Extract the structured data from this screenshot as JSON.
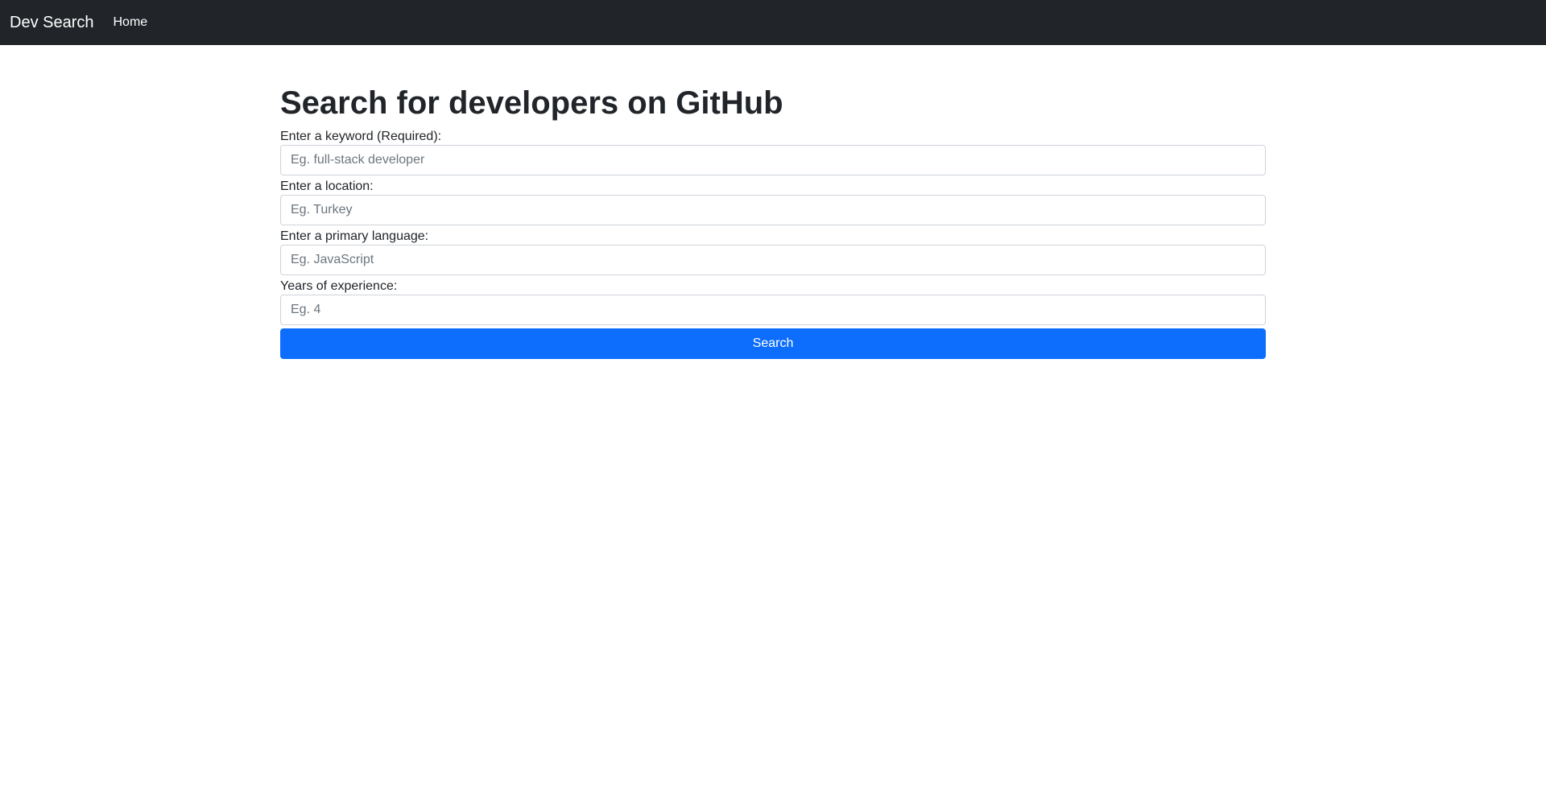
{
  "navbar": {
    "brand": "Dev Search",
    "links": [
      "Home"
    ]
  },
  "main": {
    "title": "Search for developers on GitHub",
    "fields": [
      {
        "label": "Enter a keyword (Required):",
        "placeholder": "Eg. full-stack developer",
        "value": ""
      },
      {
        "label": "Enter a location:",
        "placeholder": "Eg. Turkey",
        "value": ""
      },
      {
        "label": "Enter a primary language:",
        "placeholder": "Eg. JavaScript",
        "value": ""
      },
      {
        "label": "Years of experience:",
        "placeholder": "Eg. 4",
        "value": ""
      }
    ],
    "search_button": "Search"
  },
  "colors": {
    "navbar_bg": "#212529",
    "primary": "#0d6efd",
    "text": "#212529",
    "placeholder": "#6c757d",
    "border": "#ced4da"
  }
}
